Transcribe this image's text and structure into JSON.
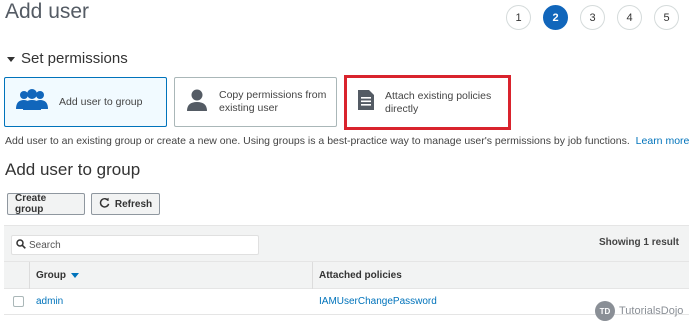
{
  "page": {
    "title": "Add user"
  },
  "steps": [
    "1",
    "2",
    "3",
    "4",
    "5"
  ],
  "active_step": "2",
  "section": {
    "title": "Set permissions"
  },
  "options": [
    {
      "label": "Add user to group",
      "icon": "users-group-icon",
      "selected": true
    },
    {
      "label": "Copy permissions from existing user",
      "icon": "user-icon",
      "selected": false
    },
    {
      "label": "Attach existing policies directly",
      "icon": "document-icon",
      "selected": false,
      "highlighted": true
    }
  ],
  "help": {
    "text": "Add user to an existing group or create a new one. Using groups is a best-practice way to manage user's permissions by job functions.",
    "link": "Learn more"
  },
  "subsection": {
    "title": "Add user to group"
  },
  "buttons": {
    "create_group": "Create group",
    "refresh": "Refresh"
  },
  "search": {
    "placeholder": "Search",
    "value": ""
  },
  "results": {
    "showing": "Showing 1 result"
  },
  "table": {
    "columns": [
      "Group",
      "Attached policies"
    ],
    "rows": [
      {
        "group": "admin",
        "policies": "IAMUserChangePassword"
      }
    ]
  },
  "watermark": {
    "logo": "TD",
    "text": "TutorialsDojo"
  },
  "colors": {
    "accent": "#1166bb",
    "link": "#0073bb",
    "highlight": "#d9232d"
  }
}
